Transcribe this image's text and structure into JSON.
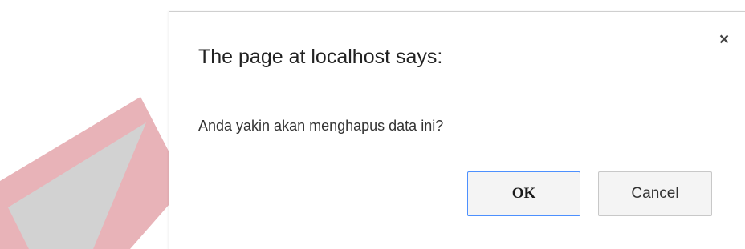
{
  "dialog": {
    "title": "The page at localhost says:",
    "message": "Anda yakin akan menghapus data ini?",
    "ok_label": "OK",
    "cancel_label": "Cancel",
    "close_glyph": "×"
  },
  "colors": {
    "watermark_red": "#e8b3b8",
    "watermark_gray": "#c9c9c9",
    "focus_border": "#4d90fe"
  }
}
